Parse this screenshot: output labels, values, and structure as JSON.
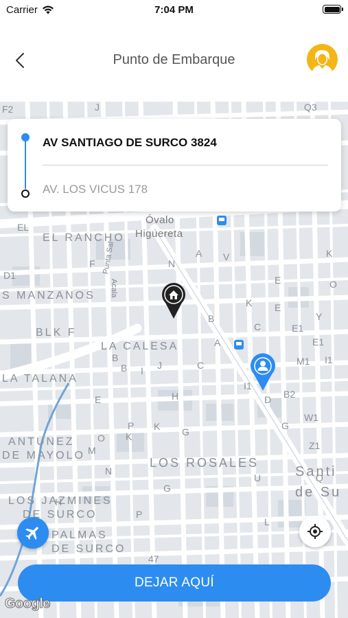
{
  "status_bar": {
    "carrier": "Carrier",
    "time": "7:04 PM",
    "battery_level": 1.0
  },
  "nav": {
    "title": "Punto de Embarque",
    "back_icon": "chevron-left-icon",
    "avatar_icon": "user-avatar-icon"
  },
  "route": {
    "origin": "AV SANTIAGO DE SURCO 3824",
    "destination": "AV. LOS VICUS 178"
  },
  "map": {
    "districts": [
      {
        "text": "EL RANCHO"
      },
      {
        "text": "S MANZANOS"
      },
      {
        "text": "BLK F"
      },
      {
        "text": "LA CALESA"
      },
      {
        "text": "LA TALANA"
      },
      {
        "text": "ANTUNEZ"
      },
      {
        "text": "DE MAYOLO"
      },
      {
        "text": "LOS ROSALES"
      },
      {
        "text": "LOS JAZMINES"
      },
      {
        "text": "DE SURCO"
      },
      {
        "text": "PALMAS"
      },
      {
        "text": "DE SURCO"
      },
      {
        "text": "Santi"
      },
      {
        "text": "de Su"
      }
    ],
    "poi": {
      "ovalo_line1": "Óvalo",
      "ovalo_line2": "Higuereta",
      "punta_sal": "Punta Sal",
      "acala": "Acala"
    },
    "block_letters": [
      "F2",
      "J",
      "Q3",
      "EL",
      "N",
      "A",
      "V",
      "K",
      "O",
      "B",
      "K",
      "E",
      "Y",
      "E1",
      "E1",
      "M1",
      "I1",
      "I1",
      "B2",
      "W1",
      "Z1",
      "A",
      "K",
      "G",
      "H",
      "C",
      "D",
      "B",
      "I",
      "J",
      "E",
      "O",
      "M",
      "N",
      "G",
      "P",
      "K",
      "47",
      "U",
      "L",
      "F",
      "D1",
      "H",
      "B",
      "E",
      "C",
      "P",
      "G",
      "Q"
    ],
    "home_pin_icon": "home-pin-icon",
    "user_pin_icon": "user-pin-icon",
    "metro_icon": "metro-station-icon",
    "road_color": "#ffffff",
    "block_color": "#e2e5e9",
    "park_color": "#cfd6dd"
  },
  "buttons": {
    "airport_icon": "airplane-icon",
    "locate_icon": "crosshair-icon",
    "confirm": "DEJAR AQUÍ"
  },
  "attribution": "Google",
  "colors": {
    "accent": "#2d8cf0",
    "avatar_bg": "#f4b517"
  }
}
